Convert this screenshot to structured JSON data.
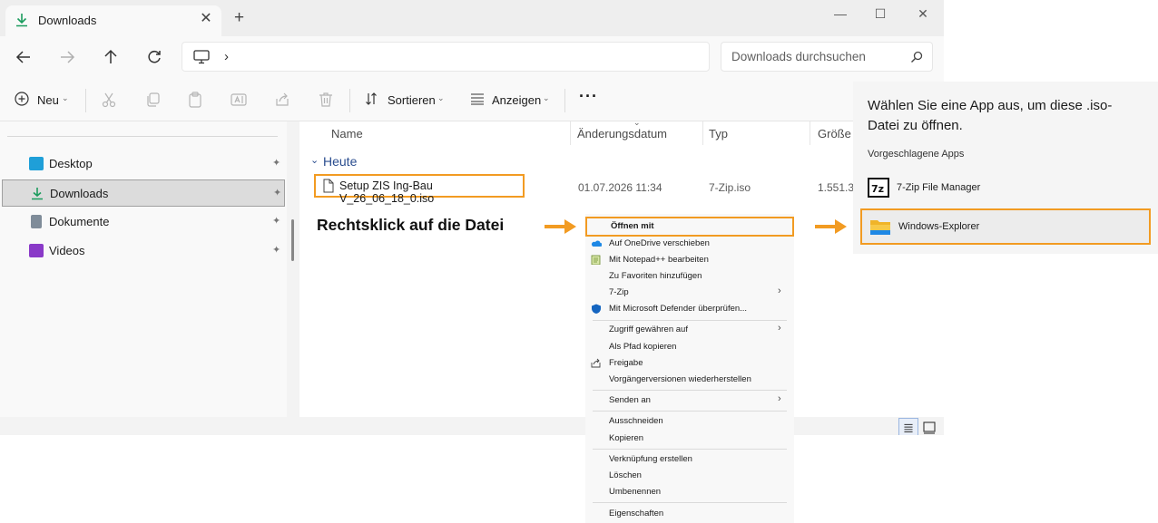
{
  "window": {
    "tab_title": "Downloads",
    "tab_close": "✕",
    "tab_add": "+",
    "min": "—",
    "max": "☐",
    "close": "✕"
  },
  "addressbar": {
    "chevron": "›",
    "search_placeholder": "Downloads durchsuchen"
  },
  "toolbar": {
    "new_label": "Neu",
    "sort_label": "Sortieren",
    "view_label": "Anzeigen",
    "more_label": "···"
  },
  "nav": {
    "items": [
      {
        "label": "Desktop",
        "icon": "desktop-icon",
        "color": "#1f9fd8"
      },
      {
        "label": "Downloads",
        "icon": "download-icon",
        "color": "#1c9c5e"
      },
      {
        "label": "Dokumente",
        "icon": "document-icon",
        "color": "#6a7a8a"
      },
      {
        "label": "Videos",
        "icon": "video-icon",
        "color": "#8a3ac8"
      }
    ],
    "pin": "📌"
  },
  "content": {
    "columns": [
      "Name",
      "Änderungsdatum",
      "Typ",
      "Größe"
    ],
    "group": "Heute",
    "file": {
      "name": "Setup ZIS Ing-Bau V_26_06_18_0.iso",
      "date": "01.07.2026 11:34",
      "type": "7-Zip.iso",
      "size": "1.551.3"
    }
  },
  "annotation": "Rechtsklick auf die Datei",
  "context_menu": {
    "items": [
      {
        "label": "Öffnen mit",
        "bold": true
      },
      {
        "label": "Auf OneDrive verschieben",
        "icon": "onedrive-icon"
      },
      {
        "label": "Mit Notepad++ bearbeiten",
        "icon": "notepad-icon"
      },
      {
        "label": "Zu Favoriten hinzufügen"
      },
      {
        "label": "7-Zip",
        "submenu": true
      },
      {
        "label": "Mit Microsoft Defender überprüfen...",
        "icon": "defender-icon"
      },
      {
        "label": "Zugriff gewähren auf",
        "submenu": true
      },
      {
        "label": "Als Pfad kopieren"
      },
      {
        "label": "Freigabe",
        "icon": "share-icon"
      },
      {
        "label": "Vorgängerversionen wiederherstellen"
      },
      {
        "label": "Senden an",
        "submenu": true
      },
      {
        "label": "Ausschneiden"
      },
      {
        "label": "Kopieren"
      },
      {
        "label": "Verknüpfung erstellen"
      },
      {
        "label": "Löschen"
      },
      {
        "label": "Umbenennen"
      },
      {
        "label": "Eigenschaften"
      }
    ]
  },
  "app_picker": {
    "title": "Wählen Sie eine App aus, um diese .iso-Datei zu öffnen.",
    "subtitle": "Vorgeschlagene Apps",
    "apps": [
      {
        "label": "7-Zip File Manager",
        "icon": "7zip-icon"
      },
      {
        "label": "Windows-Explorer",
        "icon": "folder-icon"
      }
    ]
  },
  "colors": {
    "highlight": "#f29b22",
    "accent": "#1c9c5e"
  }
}
